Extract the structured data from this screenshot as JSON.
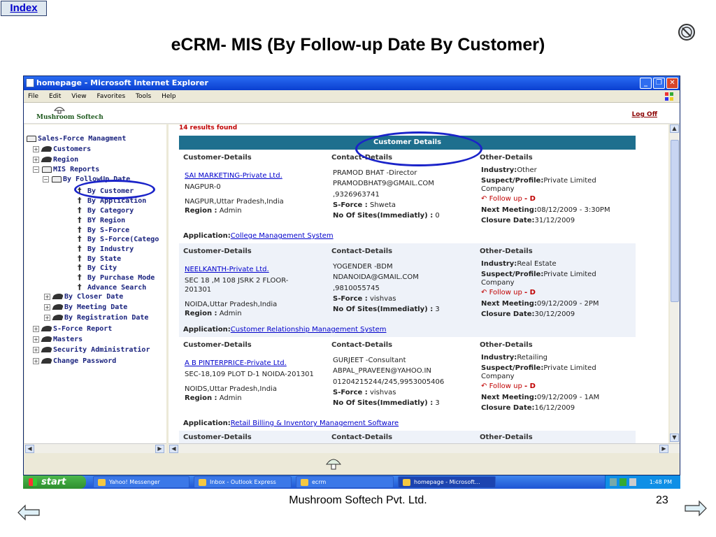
{
  "slide": {
    "index_label": "Index",
    "title": "eCRM- MIS (By Follow-up Date By Customer)",
    "footer": "Mushroom Softech Pvt. Ltd.",
    "page_number": "23"
  },
  "browser": {
    "title": "homepage - Microsoft Internet Explorer",
    "menu": [
      "File",
      "Edit",
      "View",
      "Favorites",
      "Tools",
      "Help"
    ]
  },
  "app": {
    "logo": "Mushroom Softech",
    "logoff": "Log Off"
  },
  "tree": {
    "items": [
      {
        "label": "Sales-Force Managment",
        "expander": "−",
        "icon": "book"
      },
      {
        "label": "Customers",
        "expander": "+",
        "icon": "folder"
      },
      {
        "label": "Region",
        "expander": "+",
        "icon": "folder"
      },
      {
        "label": "MIS Reports",
        "expander": "−",
        "icon": "book"
      },
      {
        "label": "By FollowUp Date",
        "expander": "−",
        "icon": "book"
      },
      {
        "label": "By Customer",
        "expander": "",
        "icon": "leaf"
      },
      {
        "label": "By Application",
        "expander": "",
        "icon": "leaf"
      },
      {
        "label": "By Category",
        "expander": "",
        "icon": "leaf"
      },
      {
        "label": "BY Region",
        "expander": "",
        "icon": "leaf"
      },
      {
        "label": "By S-Force",
        "expander": "",
        "icon": "leaf"
      },
      {
        "label": "By S-Force(Catego",
        "expander": "",
        "icon": "leaf"
      },
      {
        "label": "By Industry",
        "expander": "",
        "icon": "leaf"
      },
      {
        "label": "By State",
        "expander": "",
        "icon": "leaf"
      },
      {
        "label": "By City",
        "expander": "",
        "icon": "leaf"
      },
      {
        "label": "By Purchase Mode",
        "expander": "",
        "icon": "leaf"
      },
      {
        "label": "Advance Search",
        "expander": "",
        "icon": "leaf"
      },
      {
        "label": "By Closer Date",
        "expander": "+",
        "icon": "folder"
      },
      {
        "label": "By Meeting Date",
        "expander": "+",
        "icon": "folder"
      },
      {
        "label": "By Registration Date",
        "expander": "+",
        "icon": "folder"
      },
      {
        "label": "S-Force Report",
        "expander": "+",
        "icon": "folder"
      },
      {
        "label": "Masters",
        "expander": "+",
        "icon": "folder"
      },
      {
        "label": "Security Administratior",
        "expander": "+",
        "icon": "folder"
      },
      {
        "label": "Change Password",
        "expander": "+",
        "icon": "folder"
      }
    ]
  },
  "results": {
    "count_text": "14 results found",
    "header": "Customer Details",
    "col_customer": "Customer-Details",
    "col_contact": "Contact-Details",
    "col_other": "Other-Details",
    "labels": {
      "region": "Region :",
      "sforce": "S-Force :",
      "sites": "No Of Sites(Immediatly) :",
      "industry": "Industry:",
      "suspect": "Suspect/Profile:",
      "followup": "Follow up",
      "next_meeting": "Next Meeting:",
      "closure": "Closure Date:",
      "application": "Application:"
    },
    "records": [
      {
        "name": "SAI MARKETING-Private Ltd.",
        "addr1": "NAGPUR-0",
        "addr2": "NAGPUR,Uttar Pradesh,India",
        "region": "Admin",
        "contact": "PRAMOD BHAT -Director",
        "email": "PRAMODBHAT9@GMAIL.COM",
        "phone": ",9326963741",
        "sforce": "Shweta",
        "sites": "0",
        "industry": "Other",
        "suspect1": "Private Limited",
        "suspect2": "Company",
        "followup_mark": "- D",
        "next_meeting": "08/12/2009 - 3:30PM",
        "closure": "31/12/2009",
        "application": "College Management System"
      },
      {
        "name": "NEELKANTH-Private Ltd.",
        "addr1": "SEC 18 ,M 108 JSRK 2 FLOOR-",
        "addr1b": "201301",
        "addr2": "NOIDA,Uttar Pradesh,India",
        "region": "Admin",
        "contact": "YOGENDER -BDM",
        "email": "NDANOIDA@GMAIL.COM",
        "phone": ",9810055745",
        "sforce": "vishvas",
        "sites": "3",
        "industry": "Real Estate",
        "suspect1": "Private Limited",
        "suspect2": "Company",
        "followup_mark": "- D",
        "next_meeting": "09/12/2009 - 2PM",
        "closure": "30/12/2009",
        "application": "Customer Relationship Management System"
      },
      {
        "name": "A B PINTERPRICE-Private Ltd.",
        "addr1": "SEC-18,109 PLOT D-1 NOIDA-201301",
        "addr2": "NOIDS,Uttar Pradesh,India",
        "region": "Admin",
        "contact": "GURJEET -Consultant",
        "email": "ABPAL_PRAVEEN@YAHOO.IN",
        "phone": "01204215244/245,9953005406",
        "sforce": "vishvas",
        "sites": "3",
        "industry": "Retailing",
        "suspect1": "Private Limited",
        "suspect2": "Company",
        "followup_mark": "- D",
        "next_meeting": "09/12/2009 - 1AM",
        "closure": "16/12/2009",
        "application": "Retail Billing & Inventory Management Software"
      }
    ]
  },
  "taskbar": {
    "start": "start",
    "tasks": [
      "Yahoo! Messenger",
      "Inbox - Outlook Express",
      "ecrm",
      "homepage - Microsoft..."
    ],
    "clock": "1:48 PM"
  },
  "colors": {
    "header_bar": "#1e6f8e",
    "annotation": "#1a23c9",
    "tree_text": "#1a237e",
    "results_red": "#c00000"
  }
}
